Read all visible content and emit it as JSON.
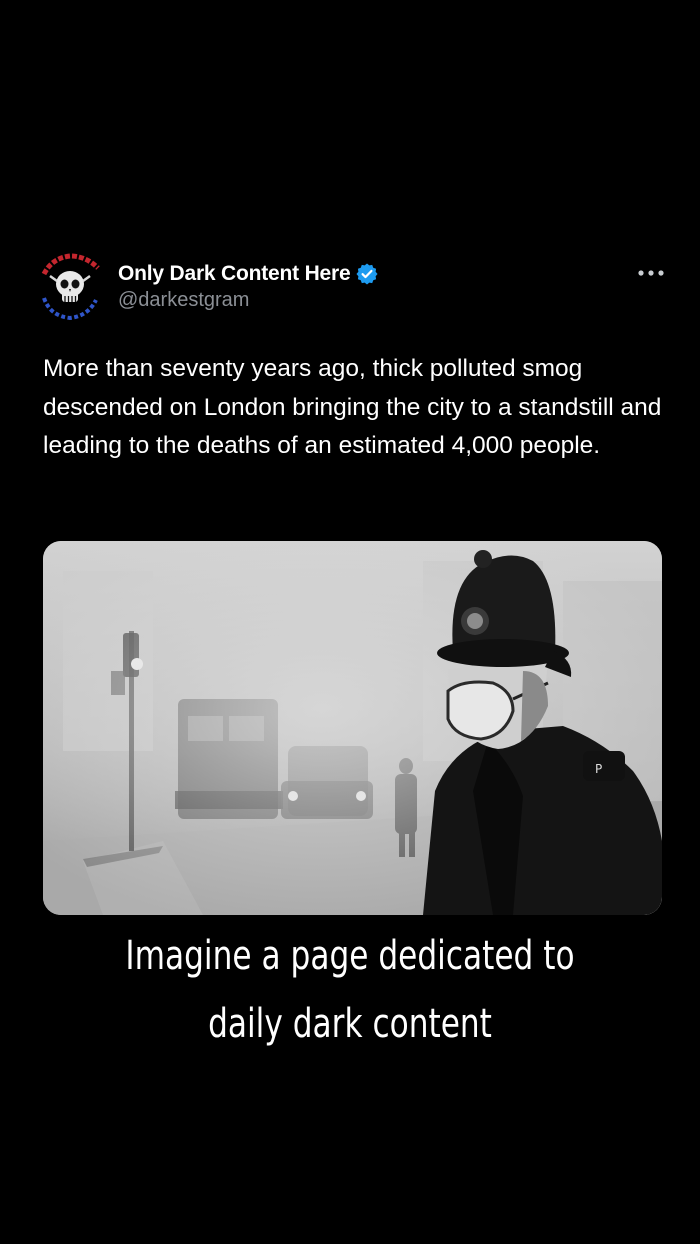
{
  "post": {
    "author": {
      "display_name": "Only Dark Content Here",
      "handle": "@darkestgram",
      "verified": true,
      "avatar_icon": "skull-logo-icon"
    },
    "more_icon": "more-horizontal-icon",
    "text": "More than seventy years ago, thick polluted smog descended on London bringing the city to a standstill and leading to the deaths of an estimated 4,000 people.",
    "media": {
      "type": "photo",
      "description_icon": "smog-police-photo"
    }
  },
  "caption": "Imagine a page dedicated to daily dark content",
  "colors": {
    "background": "#000000",
    "text": "#ffffff",
    "secondary_text": "#8b8f95",
    "verified_badge": "#1d9bf0"
  }
}
